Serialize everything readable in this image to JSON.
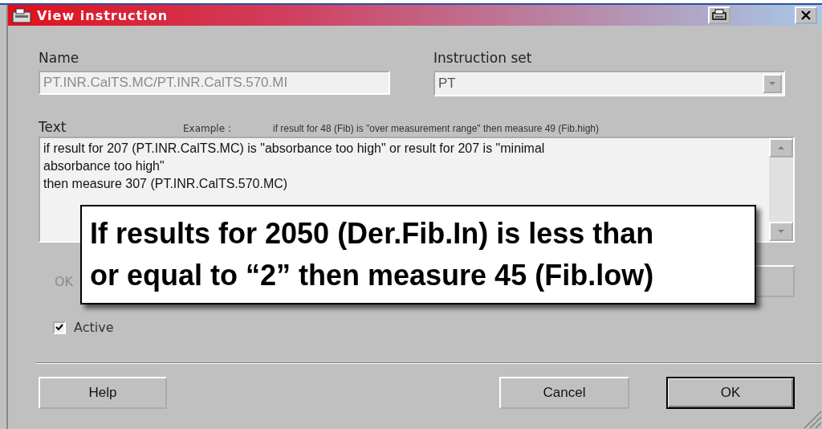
{
  "window": {
    "title": "View instruction"
  },
  "fields": {
    "name": {
      "label": "Name",
      "value": "PT.INR.CalTS.MC/PT.INR.CalTS.570.MI",
      "disabled": true
    },
    "instruction_set": {
      "label": "Instruction set",
      "value": "PT",
      "disabled": true
    }
  },
  "text": {
    "label": "Text",
    "example_label": "Example :",
    "example": "if result for 48 (Fib) is \"over measurement range\" then measure 49 (Fib.high)",
    "lines": [
      "if result for 207 (PT.INR.CalTS.MC) is \"absorbance too high\" or result for 207 is \"minimal",
      "absorbance too high\"",
      "then measure 307 (PT.INR.CalTS.570.MC)"
    ]
  },
  "hidden_row": {
    "label": "OK",
    "disabled": true
  },
  "active": {
    "label": "Active",
    "checked": true
  },
  "buttons": [
    {
      "label": "Help",
      "default": false
    },
    {
      "label": "Cancel",
      "default": false
    },
    {
      "label": "OK",
      "default": true
    }
  ],
  "callout": {
    "lines": [
      "If results for 2050 (Der.Fib.In) is less than",
      "or equal to “2” then measure 45 (Fib.low)"
    ]
  }
}
